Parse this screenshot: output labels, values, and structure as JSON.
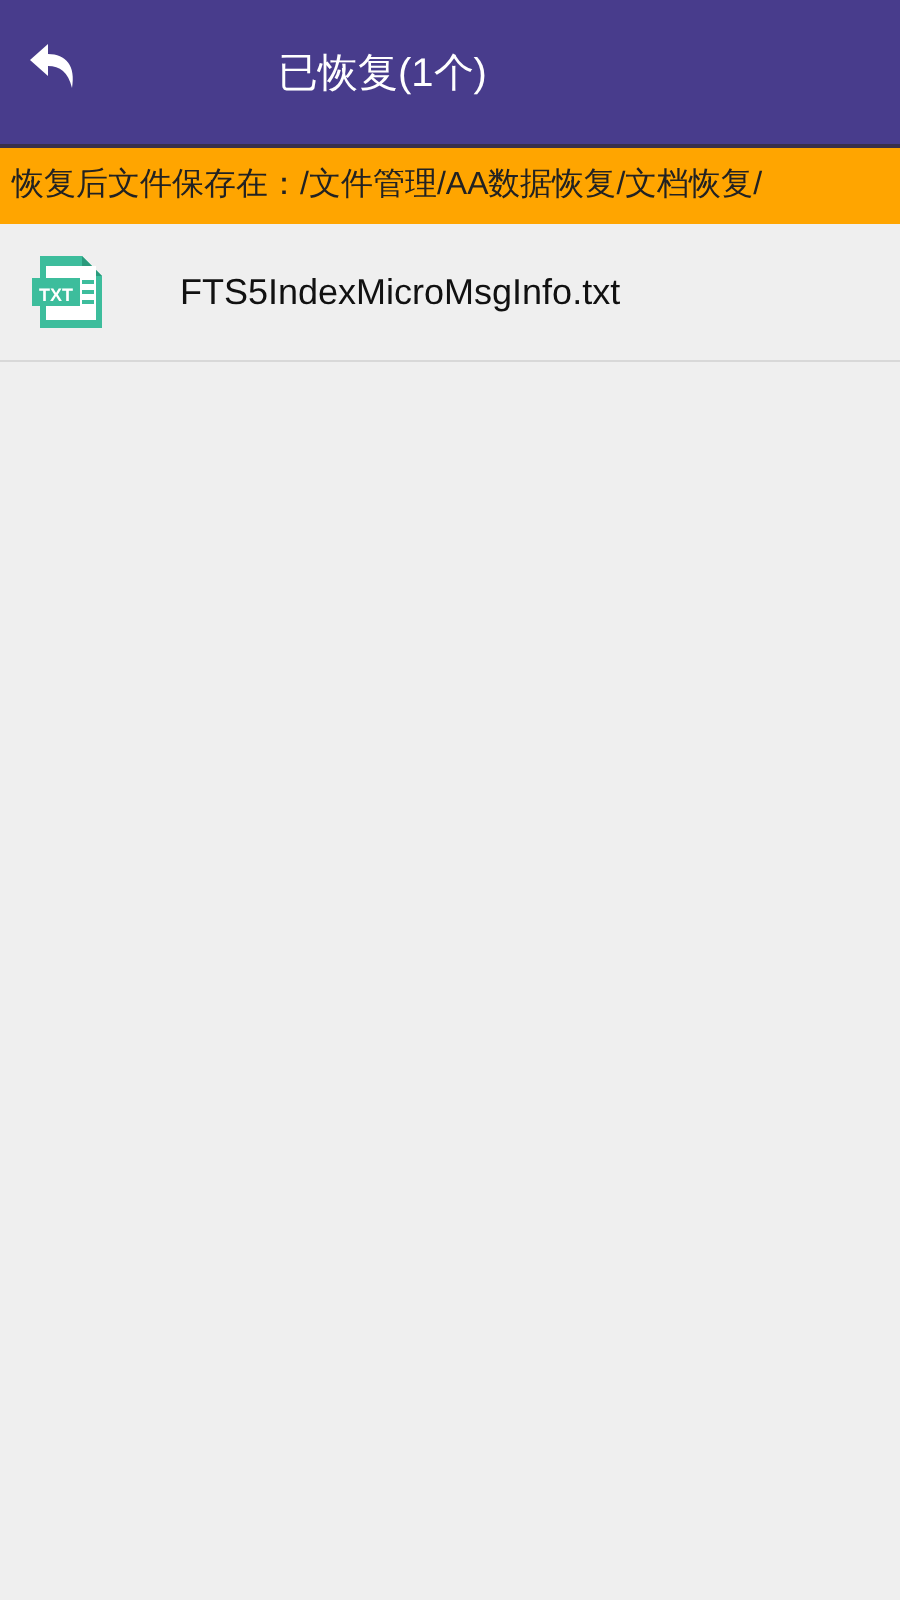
{
  "header": {
    "title": "已恢复(1个)"
  },
  "notice": "恢复后文件保存在：/文件管理/AA数据恢复/文档恢复/",
  "files": [
    {
      "kind": "txt",
      "icon_label": "TXT",
      "name": "FTS5IndexMicroMsgInfo.txt"
    }
  ]
}
